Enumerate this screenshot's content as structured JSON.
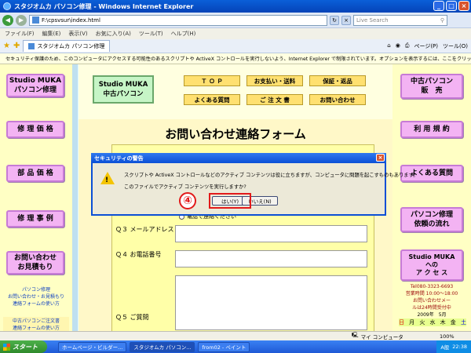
{
  "window": {
    "title": "スタジオムカ パソコン修理 - Windows Internet Explorer"
  },
  "address": {
    "url": "F:\\cpsvsur\\index.html",
    "search_placeholder": "Live Search"
  },
  "menu": [
    "ファイル(F)",
    "編集(E)",
    "表示(V)",
    "お気に入り(A)",
    "ツール(T)",
    "ヘルプ(H)"
  ],
  "tab": {
    "label": "スタジオムカ パソコン修理"
  },
  "tab_tools": {
    "page": "ページ(P)",
    "tools": "ツール(O)"
  },
  "infobar": {
    "text": "セキュリティ保護のため、このコンピュータにアクセスする可能性のあるスクリプトや ActiveX コントロールを実行しないよう、Internet Explorer で制限されています。オプションを表示するには、ここをクリックしてください..."
  },
  "left_nav": {
    "items": [
      "Studio MUKA\nパソコン修理",
      "修 理 価 格",
      "部 品 価 格",
      "修 理 事 例",
      "お問い合わせ\nお見積もり"
    ],
    "note": "パソコン修理\nお問い合わせ・お見積もり\n連絡フォームの使い方",
    "note2": "中古パソコンご注文書\n連絡フォームの使い方"
  },
  "right_nav": {
    "items": [
      "中古パソコン\n販　売",
      "利 用 規 約",
      "よくある質問",
      "パソコン修理\n依頼の流れ",
      "Studio MUKA\nへの\nア ク セ ス"
    ],
    "contact": "Tel080-3323-6693\n営業時間 10:00〜18:00\nお問い合わせメー\nルは24時間受付中",
    "calendar_title": "2009年　5月",
    "calendar_days": [
      "日",
      "月",
      "火",
      "水",
      "木",
      "金",
      "土"
    ]
  },
  "header": {
    "logo": "Studio MUKA\n中古パソコン",
    "links": [
      "Ｔ Ｏ Ｐ",
      "お支払い・送料",
      "保証・返品",
      "よくある質問",
      "ご 注 文 書",
      "お問い合わせ"
    ]
  },
  "form": {
    "title": "お問い合わせ連絡フォーム",
    "phone_option": "電話で連絡ください",
    "questions": [
      {
        "no": "Ｑ３",
        "label": "メールアドレス"
      },
      {
        "no": "Ｑ４",
        "label": "お電話番号"
      },
      {
        "no": "Ｑ５",
        "label": "ご質問"
      }
    ]
  },
  "dialog": {
    "title": "セキュリティの警告",
    "message1": "スクリプトや ActiveX コントロールなどのアクティブ コンテンツは役に立ちますが、コンピュータに問題を起こすものもあります。",
    "message2": "このファイルでアクティブ コンテンツを実行しますか?",
    "yes": "はい(Y)",
    "no": "いいえ(N)",
    "annotation": "④"
  },
  "status": {
    "zone": "マイ コンピュータ",
    "zoom": "100%"
  },
  "taskbar": {
    "start": "スタート",
    "tasks": [
      "ホームページ・ビルダー...",
      "スタジオムカ パソコン...",
      "from02 - ペイント"
    ],
    "time": "22:38",
    "ime": "A般"
  }
}
